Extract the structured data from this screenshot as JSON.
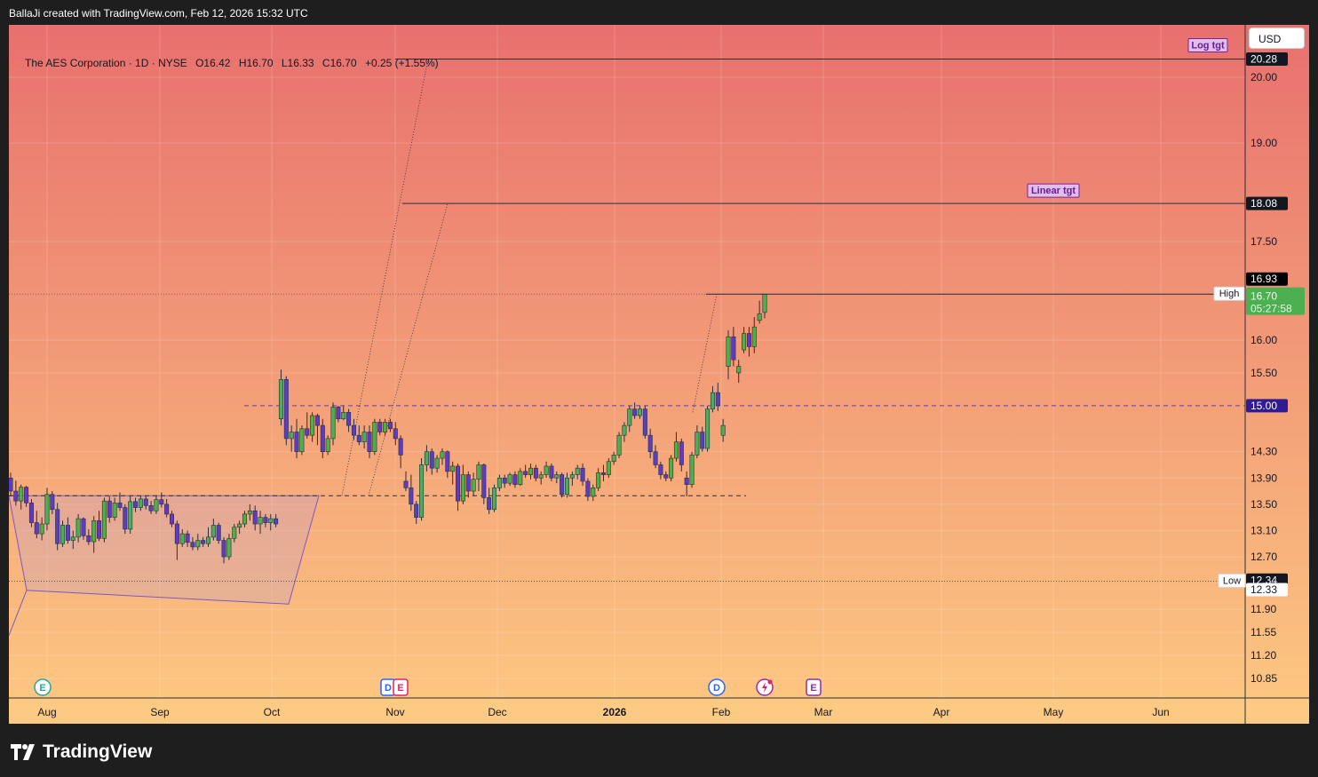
{
  "header": {
    "attribution": "BallaJi created with TradingView.com, Feb 12, 2026 15:32 UTC"
  },
  "legend": {
    "symbol": "The AES Corporation · 1D · NYSE",
    "open": "O16.42",
    "high": "H16.70",
    "low": "L16.33",
    "close": "C16.70",
    "change": "+0.25 (+1.55%)"
  },
  "currency_button": "USD",
  "brand": "TradingView",
  "colors": {
    "up": "#4caf50",
    "down": "#5b3cc4",
    "bg_top": "#e8706e",
    "bg_bottom": "#fdc981"
  },
  "chart_data": {
    "type": "candlestick",
    "y_range": [
      10.55,
      20.8
    ],
    "y_ticks": [
      "20.00",
      "19.00",
      "17.50",
      "16.00",
      "15.50",
      "14.30",
      "13.90",
      "13.50",
      "13.10",
      "12.70",
      "11.90",
      "11.55",
      "11.20",
      "10.85"
    ],
    "x_ticks": [
      "Aug",
      "Sep",
      "Oct",
      "Nov",
      "Dec",
      "2026",
      "Feb",
      "Mar",
      "Apr",
      "May",
      "Jun"
    ],
    "candles_ohlc": [
      [
        13.9,
        13.98,
        13.62,
        13.7
      ],
      [
        13.7,
        13.86,
        13.48,
        13.55
      ],
      [
        13.55,
        13.8,
        13.42,
        13.76
      ],
      [
        13.76,
        13.78,
        13.46,
        13.52
      ],
      [
        13.52,
        13.58,
        13.15,
        13.22
      ],
      [
        13.22,
        13.4,
        12.98,
        13.05
      ],
      [
        13.05,
        13.3,
        12.95,
        13.2
      ],
      [
        13.2,
        13.75,
        13.1,
        13.65
      ],
      [
        13.65,
        13.7,
        13.35,
        13.42
      ],
      [
        13.42,
        13.52,
        12.8,
        12.9
      ],
      [
        12.9,
        13.25,
        12.85,
        13.18
      ],
      [
        13.18,
        13.3,
        12.9,
        12.95
      ],
      [
        12.95,
        13.1,
        12.82,
        13.0
      ],
      [
        13.0,
        13.35,
        12.92,
        13.28
      ],
      [
        13.28,
        13.3,
        12.96,
        13.02
      ],
      [
        13.02,
        13.12,
        12.88,
        12.93
      ],
      [
        12.93,
        13.32,
        12.76,
        13.25
      ],
      [
        13.25,
        13.4,
        12.94,
        12.98
      ],
      [
        12.98,
        13.6,
        12.92,
        13.55
      ],
      [
        13.55,
        13.62,
        13.22,
        13.3
      ],
      [
        13.3,
        13.6,
        13.25,
        13.52
      ],
      [
        13.52,
        13.68,
        13.4,
        13.45
      ],
      [
        13.45,
        13.5,
        13.05,
        13.12
      ],
      [
        13.12,
        13.62,
        13.05,
        13.54
      ],
      [
        13.54,
        13.6,
        13.38,
        13.45
      ],
      [
        13.45,
        13.62,
        13.4,
        13.58
      ],
      [
        13.58,
        13.62,
        13.42,
        13.48
      ],
      [
        13.48,
        13.55,
        13.35,
        13.4
      ],
      [
        13.4,
        13.62,
        13.35,
        13.57
      ],
      [
        13.57,
        13.68,
        13.45,
        13.5
      ],
      [
        13.5,
        13.58,
        13.3,
        13.35
      ],
      [
        13.35,
        13.4,
        13.15,
        13.2
      ],
      [
        13.2,
        13.25,
        12.65,
        12.9
      ],
      [
        12.9,
        13.12,
        12.85,
        13.05
      ],
      [
        13.05,
        13.1,
        12.85,
        12.92
      ],
      [
        12.92,
        13.0,
        12.8,
        12.85
      ],
      [
        12.85,
        13.05,
        12.8,
        12.95
      ],
      [
        12.95,
        13.0,
        12.85,
        12.9
      ],
      [
        12.9,
        13.15,
        12.85,
        13.0
      ],
      [
        13.0,
        13.28,
        12.95,
        13.18
      ],
      [
        13.18,
        13.22,
        12.9,
        12.95
      ],
      [
        12.95,
        13.0,
        12.6,
        12.7
      ],
      [
        12.7,
        13.05,
        12.65,
        12.98
      ],
      [
        12.98,
        13.2,
        12.92,
        13.15
      ],
      [
        13.15,
        13.25,
        13.05,
        13.2
      ],
      [
        13.2,
        13.4,
        13.15,
        13.35
      ],
      [
        13.35,
        13.5,
        13.25,
        13.4
      ],
      [
        13.4,
        13.48,
        13.1,
        13.2
      ],
      [
        13.2,
        13.4,
        13.05,
        13.3
      ],
      [
        13.3,
        13.35,
        13.15,
        13.22
      ],
      [
        13.22,
        13.35,
        13.1,
        13.28
      ],
      [
        13.28,
        13.35,
        13.15,
        13.2
      ],
      [
        14.8,
        15.55,
        14.7,
        15.4
      ],
      [
        15.4,
        15.45,
        14.4,
        14.5
      ],
      [
        14.5,
        14.7,
        14.3,
        14.6
      ],
      [
        14.6,
        14.8,
        14.2,
        14.3
      ],
      [
        14.3,
        14.7,
        14.25,
        14.65
      ],
      [
        14.65,
        14.9,
        14.5,
        14.55
      ],
      [
        14.55,
        14.9,
        14.45,
        14.85
      ],
      [
        14.85,
        14.88,
        14.4,
        14.7
      ],
      [
        14.7,
        14.8,
        14.2,
        14.3
      ],
      [
        14.3,
        14.55,
        14.25,
        14.5
      ],
      [
        14.5,
        15.05,
        14.4,
        14.98
      ],
      [
        14.98,
        15.0,
        14.75,
        14.8
      ],
      [
        14.8,
        15.0,
        14.78,
        14.9
      ],
      [
        14.9,
        14.95,
        14.6,
        14.7
      ],
      [
        14.7,
        14.8,
        14.48,
        14.55
      ],
      [
        14.55,
        14.7,
        14.4,
        14.45
      ],
      [
        14.45,
        14.7,
        14.35,
        14.6
      ],
      [
        14.6,
        14.7,
        14.2,
        14.3
      ],
      [
        14.3,
        14.8,
        14.25,
        14.75
      ],
      [
        14.75,
        14.8,
        14.55,
        14.6
      ],
      [
        14.6,
        14.8,
        14.55,
        14.75
      ],
      [
        14.75,
        14.8,
        14.6,
        14.65
      ],
      [
        14.65,
        14.75,
        14.4,
        14.5
      ],
      [
        14.5,
        14.55,
        14.05,
        14.25
      ],
      [
        13.85,
        14.0,
        13.7,
        13.75
      ],
      [
        13.75,
        13.95,
        13.4,
        13.5
      ],
      [
        13.5,
        13.55,
        13.2,
        13.3
      ],
      [
        13.3,
        14.2,
        13.25,
        14.1
      ],
      [
        14.1,
        14.4,
        14.0,
        14.3
      ],
      [
        14.3,
        14.35,
        13.95,
        14.05
      ],
      [
        14.05,
        14.25,
        13.98,
        14.2
      ],
      [
        14.2,
        14.35,
        14.1,
        14.3
      ],
      [
        14.3,
        14.32,
        13.9,
        14.0
      ],
      [
        14.0,
        14.15,
        13.8,
        14.08
      ],
      [
        14.08,
        14.12,
        13.4,
        13.55
      ],
      [
        13.55,
        14.1,
        13.5,
        13.95
      ],
      [
        13.95,
        14.0,
        13.6,
        13.7
      ],
      [
        13.7,
        13.98,
        13.62,
        13.88
      ],
      [
        13.88,
        14.15,
        13.7,
        14.1
      ],
      [
        14.1,
        14.12,
        13.5,
        13.6
      ],
      [
        13.6,
        13.75,
        13.35,
        13.42
      ],
      [
        13.42,
        13.8,
        13.38,
        13.75
      ],
      [
        13.75,
        13.95,
        13.7,
        13.9
      ],
      [
        13.9,
        13.95,
        13.75,
        13.82
      ],
      [
        13.82,
        13.98,
        13.78,
        13.95
      ],
      [
        13.95,
        14.0,
        13.75,
        13.8
      ],
      [
        13.8,
        14.05,
        13.78,
        14.0
      ],
      [
        14.0,
        14.1,
        13.9,
        13.95
      ],
      [
        13.95,
        14.12,
        13.88,
        14.05
      ],
      [
        14.05,
        14.1,
        13.85,
        13.9
      ],
      [
        13.9,
        14.0,
        13.8,
        13.95
      ],
      [
        13.95,
        14.15,
        13.9,
        14.08
      ],
      [
        14.08,
        14.12,
        13.85,
        13.9
      ],
      [
        13.9,
        14.0,
        13.82,
        13.95
      ],
      [
        13.95,
        13.98,
        13.6,
        13.65
      ],
      [
        13.65,
        13.98,
        13.6,
        13.9
      ],
      [
        13.9,
        14.0,
        13.78,
        13.95
      ],
      [
        13.95,
        14.1,
        13.88,
        14.05
      ],
      [
        14.05,
        14.12,
        13.78,
        13.85
      ],
      [
        13.85,
        13.9,
        13.55,
        13.62
      ],
      [
        13.62,
        13.8,
        13.55,
        13.75
      ],
      [
        13.75,
        14.05,
        13.7,
        13.98
      ],
      [
        13.98,
        14.1,
        13.85,
        13.95
      ],
      [
        13.95,
        14.2,
        13.9,
        14.15
      ],
      [
        14.15,
        14.3,
        14.1,
        14.25
      ],
      [
        14.25,
        14.6,
        14.2,
        14.55
      ],
      [
        14.55,
        14.75,
        14.45,
        14.7
      ],
      [
        14.7,
        15.0,
        14.6,
        14.95
      ],
      [
        14.95,
        15.05,
        14.8,
        14.85
      ],
      [
        14.85,
        15.0,
        14.8,
        14.95
      ],
      [
        14.95,
        15.0,
        14.5,
        14.55
      ],
      [
        14.55,
        14.65,
        14.2,
        14.3
      ],
      [
        14.3,
        14.4,
        14.05,
        14.1
      ],
      [
        14.1,
        14.15,
        13.88,
        13.95
      ],
      [
        13.95,
        14.0,
        13.85,
        13.9
      ],
      [
        13.9,
        14.25,
        13.85,
        14.2
      ],
      [
        14.2,
        14.6,
        14.15,
        14.45
      ],
      [
        14.45,
        14.5,
        14.0,
        14.1
      ],
      [
        13.9,
        14.0,
        13.62,
        13.8
      ],
      [
        13.8,
        14.3,
        13.75,
        14.25
      ],
      [
        14.25,
        14.7,
        14.2,
        14.6
      ],
      [
        14.6,
        14.68,
        14.3,
        14.35
      ],
      [
        14.35,
        15.0,
        14.3,
        14.95
      ],
      [
        14.95,
        15.3,
        14.9,
        15.2
      ],
      [
        15.2,
        15.35,
        14.92,
        15.0
      ],
      [
        14.55,
        14.8,
        14.45,
        14.7
      ],
      [
        15.6,
        16.15,
        15.4,
        16.05
      ],
      [
        16.05,
        16.2,
        15.6,
        15.7
      ],
      [
        15.5,
        15.7,
        15.35,
        15.6
      ],
      [
        15.85,
        16.2,
        15.8,
        16.1
      ],
      [
        16.1,
        16.2,
        15.75,
        15.9
      ],
      [
        15.9,
        16.35,
        15.8,
        16.2
      ],
      [
        16.3,
        16.6,
        16.25,
        16.4
      ],
      [
        16.42,
        16.7,
        16.33,
        16.7
      ]
    ],
    "horizontal_levels": [
      {
        "label": "Log tgt",
        "value": 20.28
      },
      {
        "label": "Linear tgt",
        "value": 18.08
      },
      {
        "label": "High",
        "value": 16.7
      },
      {
        "label": "Low",
        "value": 12.33
      }
    ],
    "price_tags": [
      "20.28",
      "18.08",
      "16.93",
      "16.70",
      "16.70",
      "15.00",
      "12.34",
      "12.33"
    ],
    "countdown": "05:27:58",
    "event_markers": [
      "E",
      "D",
      "E",
      "D",
      "E"
    ]
  }
}
